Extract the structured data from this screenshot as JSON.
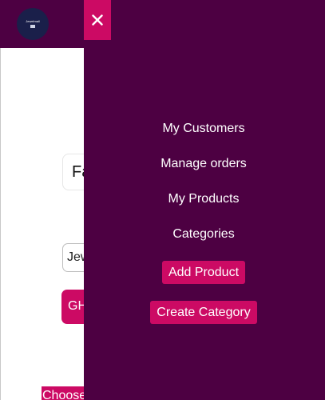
{
  "header": {
    "logo_text": "Jewelmall"
  },
  "form": {
    "name_value": "Fa",
    "category_value": "Jewelry",
    "currency_label": "GHS",
    "choose_file_label": "Choose File"
  },
  "drawer": {
    "close_icon": "close-icon",
    "links": [
      {
        "label": "My Customers"
      },
      {
        "label": "Manage orders"
      },
      {
        "label": "My Products"
      },
      {
        "label": "Categories"
      }
    ],
    "buttons": {
      "add_product": "Add Product",
      "create_category": "Create Category"
    }
  },
  "colors": {
    "drawer_bg": "#4d0042",
    "accent": "#cc0a64",
    "text_on_dark": "#ffffff"
  }
}
